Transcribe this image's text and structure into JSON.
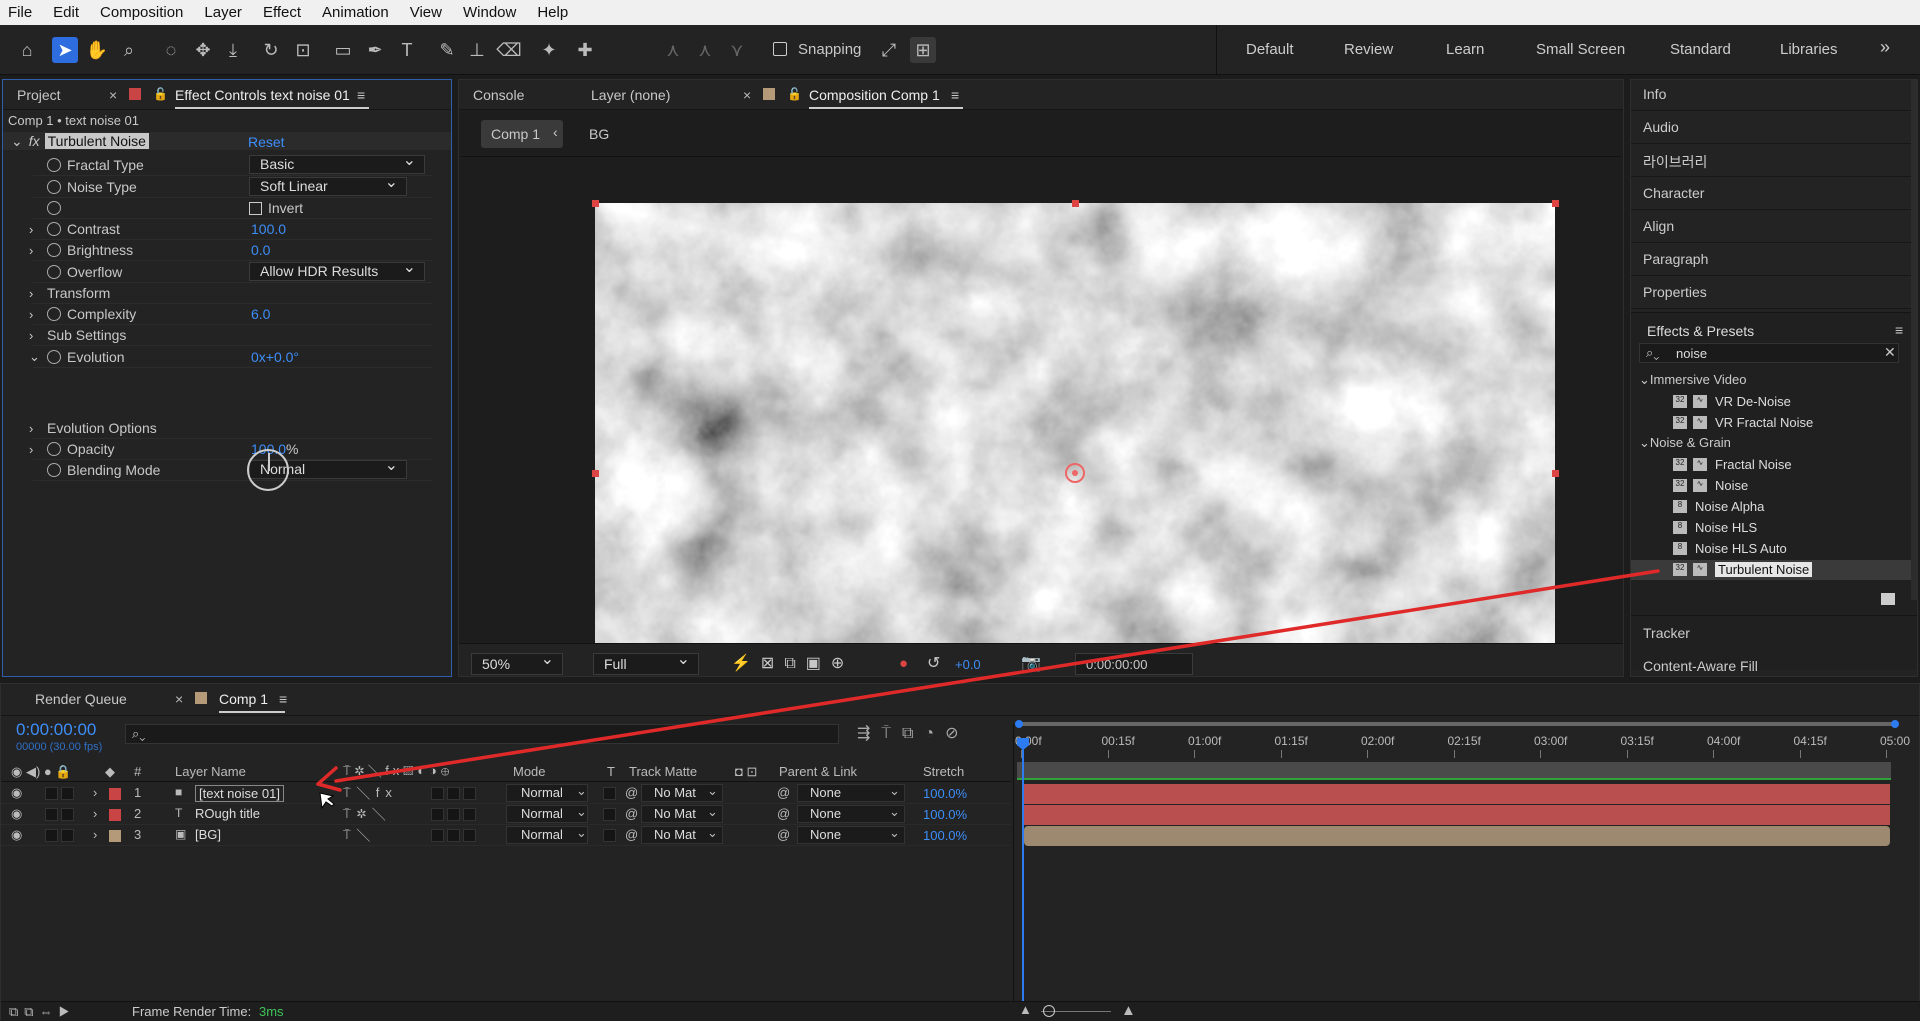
{
  "menu": [
    "File",
    "Edit",
    "Composition",
    "Layer",
    "Effect",
    "Animation",
    "View",
    "Window",
    "Help"
  ],
  "toolbar": {
    "snapping": "Snapping",
    "workspaces": [
      "Default",
      "Review",
      "Learn",
      "Small Screen",
      "Standard",
      "Libraries"
    ],
    "more": "»"
  },
  "left_panel": {
    "tab_project": "Project",
    "tab_effect": "Effect Controls text noise 01",
    "path": "Comp 1 • text noise 01",
    "effect_name": "Turbulent Noise",
    "reset": "Reset",
    "props": [
      {
        "label": "Fractal Type",
        "value": "Basic",
        "kind": "dropdown"
      },
      {
        "label": "Noise Type",
        "value": "Soft Linear",
        "kind": "dropdown"
      },
      {
        "label": "",
        "value": "Invert",
        "kind": "checkbox"
      },
      {
        "label": "Contrast",
        "value": "100.0",
        "kind": "num"
      },
      {
        "label": "Brightness",
        "value": "0.0",
        "kind": "num"
      },
      {
        "label": "Overflow",
        "value": "Allow HDR Results",
        "kind": "dropdown"
      },
      {
        "label": "Transform",
        "value": "",
        "kind": "group"
      },
      {
        "label": "Complexity",
        "value": "6.0",
        "kind": "num"
      },
      {
        "label": "Sub Settings",
        "value": "",
        "kind": "group"
      },
      {
        "label": "Evolution",
        "value": "0x+0.0°",
        "kind": "num"
      },
      {
        "label": "Evolution Options",
        "value": "",
        "kind": "group"
      },
      {
        "label": "Opacity",
        "value": "100.0",
        "unit": "%",
        "kind": "num"
      },
      {
        "label": "Blending Mode",
        "value": "Normal",
        "kind": "dropdown"
      }
    ]
  },
  "viewer": {
    "tab_console": "Console",
    "tab_layer": "Layer (none)",
    "tab_comp": "Composition Comp 1",
    "crumb_comp": "Comp 1",
    "crumb_bg": "BG",
    "zoom": "50%",
    "resolution": "Full",
    "exposure": "+0.0",
    "timecode": "0:00:00:00"
  },
  "right_panel": {
    "items": [
      "Info",
      "Audio",
      "라이브러리",
      "Character",
      "Align",
      "Paragraph",
      "Properties"
    ],
    "effects_title": "Effects & Presets",
    "search": "noise",
    "groups": [
      {
        "name": "Immersive Video",
        "items": [
          "VR De-Noise",
          "VR Fractal Noise"
        ]
      },
      {
        "name": "Noise & Grain",
        "items": [
          "Fractal Noise",
          "Noise",
          "Noise Alpha",
          "Noise HLS",
          "Noise HLS Auto",
          "Turbulent Noise"
        ]
      }
    ],
    "bottom": [
      "Tracker",
      "Content-Aware Fill"
    ]
  },
  "timeline": {
    "tab_render": "Render Queue",
    "tab_comp": "Comp 1",
    "time": "0:00:00:00",
    "fps": "00000 (30.00 fps)",
    "headers": {
      "layer_name": "Layer Name",
      "mode": "Mode",
      "t": "T",
      "track_matte": "Track Matte",
      "parent": "Parent & Link",
      "stretch": "Stretch",
      "num": "#"
    },
    "ruler": [
      "0:00f",
      "00:15f",
      "01:00f",
      "01:15f",
      "02:00f",
      "02:15f",
      "03:00f",
      "03:15f",
      "04:00f",
      "04:15f",
      "05:00"
    ],
    "layers": [
      {
        "num": "1",
        "name": "[text noise 01]",
        "mode": "Normal",
        "matte": "No Mat",
        "parent": "None",
        "stretch": "100.0%",
        "color": "#c94444",
        "bar": "#b94f4f"
      },
      {
        "num": "2",
        "name": "ROugh    title",
        "mode": "Normal",
        "matte": "No Mat",
        "parent": "None",
        "stretch": "100.0%",
        "color": "#c94444",
        "bar": "#b94f4f"
      },
      {
        "num": "3",
        "name": "[BG]",
        "mode": "Normal",
        "matte": "No Mat",
        "parent": "None",
        "stretch": "100.0%",
        "color": "#b59a7a",
        "bar": "#9d8870"
      }
    ],
    "status_label": "Frame Render Time:",
    "status_value": "3ms"
  }
}
